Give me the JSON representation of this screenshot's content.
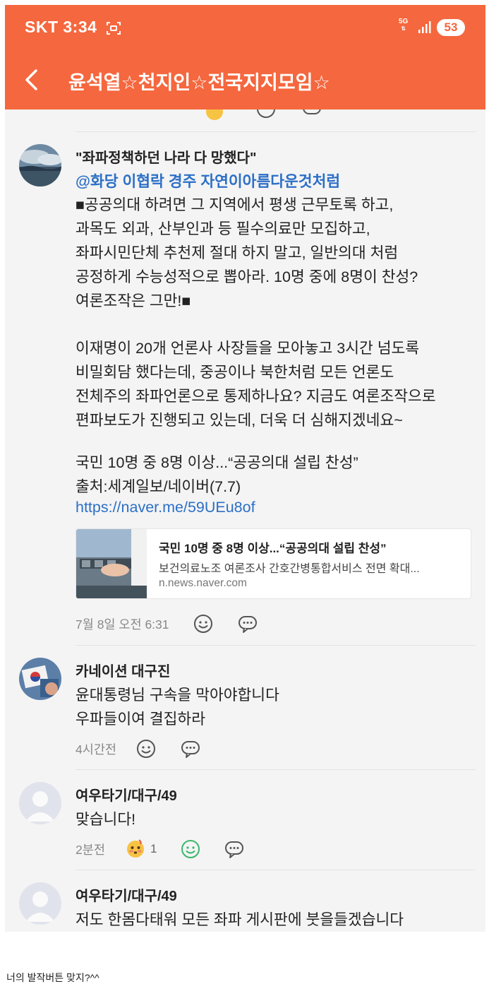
{
  "status_bar": {
    "carrier": "SKT",
    "time": "3:34",
    "network": "5G",
    "battery": "53"
  },
  "app_bar": {
    "title": "윤석열☆천지인☆전국지지모임☆"
  },
  "comments": [
    {
      "headline": "\"좌파정책하던 나라 다 망했다\"",
      "mention": "@화당  이협락  경주    자연이아름다운것처럼",
      "lines": [
        "■공공의대 하려면 그 지역에서 평생 근무토록 하고,",
        "과목도 외과, 산부인과 등 필수의료만 모집하고,",
        "좌파시민단체 추천제 절대 하지 말고, 일반의대 처럼",
        "공정하게 수능성적으로 뽑아라. 10명 중에 8명이 찬성?",
        "여론조작은 그만!■",
        "이재명이 20개 언론사 사장들을 모아놓고 3시간 넘도록",
        "비밀회담 했다는데, 중공이나 북한처럼 모든 언론도",
        "전체주의 좌파언론으로 통제하나요? 지금도 여론조작으로",
        "편파보도가 진행되고 있는데, 더욱 더 심해지겠네요~",
        "국민 10명 중 8명 이상...“공공의대 설립 찬성”",
        "출처:세계일보/네이버(7.7)"
      ],
      "link": "https://naver.me/59UEu8of",
      "card": {
        "title": "국민 10명 중 8명 이상...“공공의대 설립 찬성”",
        "description": "보건의료노조 여론조사 간호간병통합서비스 전면 확대...",
        "domain": "n.news.naver.com"
      },
      "time": "7월 8일 오전 6:31"
    },
    {
      "author": "카네이션 대구진",
      "lines": [
        "윤대통령님 구속을 막아야합니다",
        "우파들이여 결집하라"
      ],
      "time": "4시간전"
    },
    {
      "author": "여우타기/대구/49",
      "lines": [
        "맞습니다!"
      ],
      "time": "2분전",
      "reaction_count": "1"
    },
    {
      "author": "여우타기/대구/49",
      "lines": [
        "저도 한몸다태워 모든 좌파 게시판에 붓을들겠습니다"
      ]
    }
  ],
  "caption": "너의 발작버튼 맞지?^^",
  "icons": {
    "back": "back-arrow-icon",
    "emoji": "smiley-icon",
    "reply": "speech-bubble-icon",
    "reaction": "flushed-emoji-icon"
  },
  "colors": {
    "header": "#f5673e",
    "link": "#2c6fc6",
    "active_reaction": "#3cb66c"
  }
}
